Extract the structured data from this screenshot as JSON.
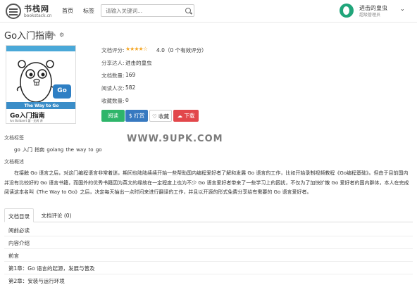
{
  "header": {
    "logo_name": "书栈网",
    "logo_sub": "bookstack.cn",
    "nav": [
      "首页",
      "标签"
    ],
    "search_placeholder": "请输入关键词...",
    "user_name": "进击的皇虫",
    "user_level": "超级管理员"
  },
  "book": {
    "title": "Go入门指南",
    "cover": {
      "strip": "The Way to Go",
      "badge": "Go",
      "title": "Go入门指南",
      "author": "Ivo Balbaert 著 · 无闻 译"
    },
    "info": [
      {
        "label": "文档评分:",
        "value": "4.0（0 个有效评分）"
      },
      {
        "label": "分享达人:",
        "value": "进击的皇虫"
      },
      {
        "label": "文档数量:",
        "value": "169"
      },
      {
        "label": "阅读人次:",
        "value": "582"
      },
      {
        "label": "收藏数量:",
        "value": "0"
      }
    ],
    "rating_stars": 4,
    "buttons": {
      "read": "阅读",
      "reward": "$ 打赏",
      "fav": "♡ 收藏",
      "download": "☁ 下载"
    }
  },
  "watermark": "WWW.9UPK.COM",
  "tags_label": "文档标签",
  "tags": "go   入门   指南   golang   the way to go",
  "desc_label": "文档概述",
  "description": "在接触 Go 语言之后，对这门编程语言非常着迷，期间也陆陆续续开始一些帮助国内编程爱好者了解和发展 Go 语言的工作，比如开始录制视频教程《Go编程基础》。但由于目前国内并没有比较好的 Go 语言书籍，而国外的优秀书籍因为英文的缘故在一定程度上也为不少 Go 语言爱好者带来了一些学习上的困扰，不仅为了加快扩散 Go 爱好者的国内群体，本人在完成阅读这本名叫《The Way to Go》之后，决定每天抽出一点时间来进行翻译的工作，并且以开源的形式免费分享给有需要的 Go 语言爱好者。",
  "tabs": [
    "文档目录",
    "文档评论 (0)"
  ],
  "toc": [
    "阅前必读",
    "内容介绍",
    "前言",
    "第1章：Go 语言的起源，发展与普及",
    "第2章：安装与运行环境"
  ]
}
